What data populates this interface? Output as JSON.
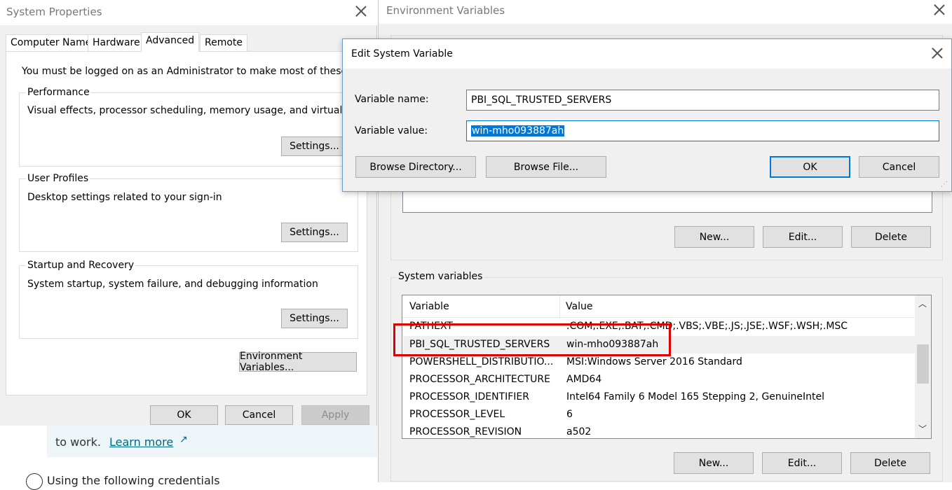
{
  "sysprops": {
    "title": "System Properties",
    "tabs": [
      "Computer Name",
      "Hardware",
      "Advanced",
      "Remote"
    ],
    "active_tab": "Advanced",
    "admin_note": "You must be logged on as an Administrator to make most of these change",
    "performance": {
      "label": "Performance",
      "desc": "Visual effects, processor scheduling, memory usage, and virtual memory",
      "button": "Settings..."
    },
    "user_profiles": {
      "label": "User Profiles",
      "desc": "Desktop settings related to your sign-in",
      "button": "Settings..."
    },
    "startup": {
      "label": "Startup and Recovery",
      "desc": "System startup, system failure, and debugging information",
      "button": "Settings..."
    },
    "env_button": "Environment Variables...",
    "ok": "OK",
    "cancel": "Cancel",
    "apply": "Apply"
  },
  "background": {
    "text": "to work.",
    "link": "Learn more",
    "radio_label": "Using the following credentials"
  },
  "envvars": {
    "title": "Environment Variables",
    "user_buttons": {
      "new": "New...",
      "edit": "Edit...",
      "delete": "Delete"
    },
    "system_label": "System variables",
    "columns": [
      "Variable",
      "Value"
    ],
    "rows": [
      {
        "name": "PATHEXT",
        "value": ".COM;.EXE;.BAT;.CMD;.VBS;.VBE;.JS;.JSE;.WSF;.WSH;.MSC"
      },
      {
        "name": "PBI_SQL_TRUSTED_SERVERS",
        "value": "win-mho093887ah"
      },
      {
        "name": "POWERSHELL_DISTRIBUTIO...",
        "value": "MSI:Windows Server 2016 Standard"
      },
      {
        "name": "PROCESSOR_ARCHITECTURE",
        "value": "AMD64"
      },
      {
        "name": "PROCESSOR_IDENTIFIER",
        "value": "Intel64 Family 6 Model 165 Stepping 2, GenuineIntel"
      },
      {
        "name": "PROCESSOR_LEVEL",
        "value": "6"
      },
      {
        "name": "PROCESSOR_REVISION",
        "value": "a502"
      }
    ],
    "system_buttons": {
      "new": "New...",
      "edit": "Edit...",
      "delete": "Delete"
    }
  },
  "edit_dialog": {
    "title": "Edit System Variable",
    "name_label": "Variable name:",
    "name_value": "PBI_SQL_TRUSTED_SERVERS",
    "value_label": "Variable value:",
    "value_value": "win-mho093887ah",
    "browse_dir": "Browse Directory...",
    "browse_file": "Browse File...",
    "ok": "OK",
    "cancel": "Cancel"
  },
  "colors": {
    "accent": "#0078d7",
    "highlight_box": "#e00000",
    "link": "#006a80",
    "dialog_border": "#6d9ad0"
  }
}
